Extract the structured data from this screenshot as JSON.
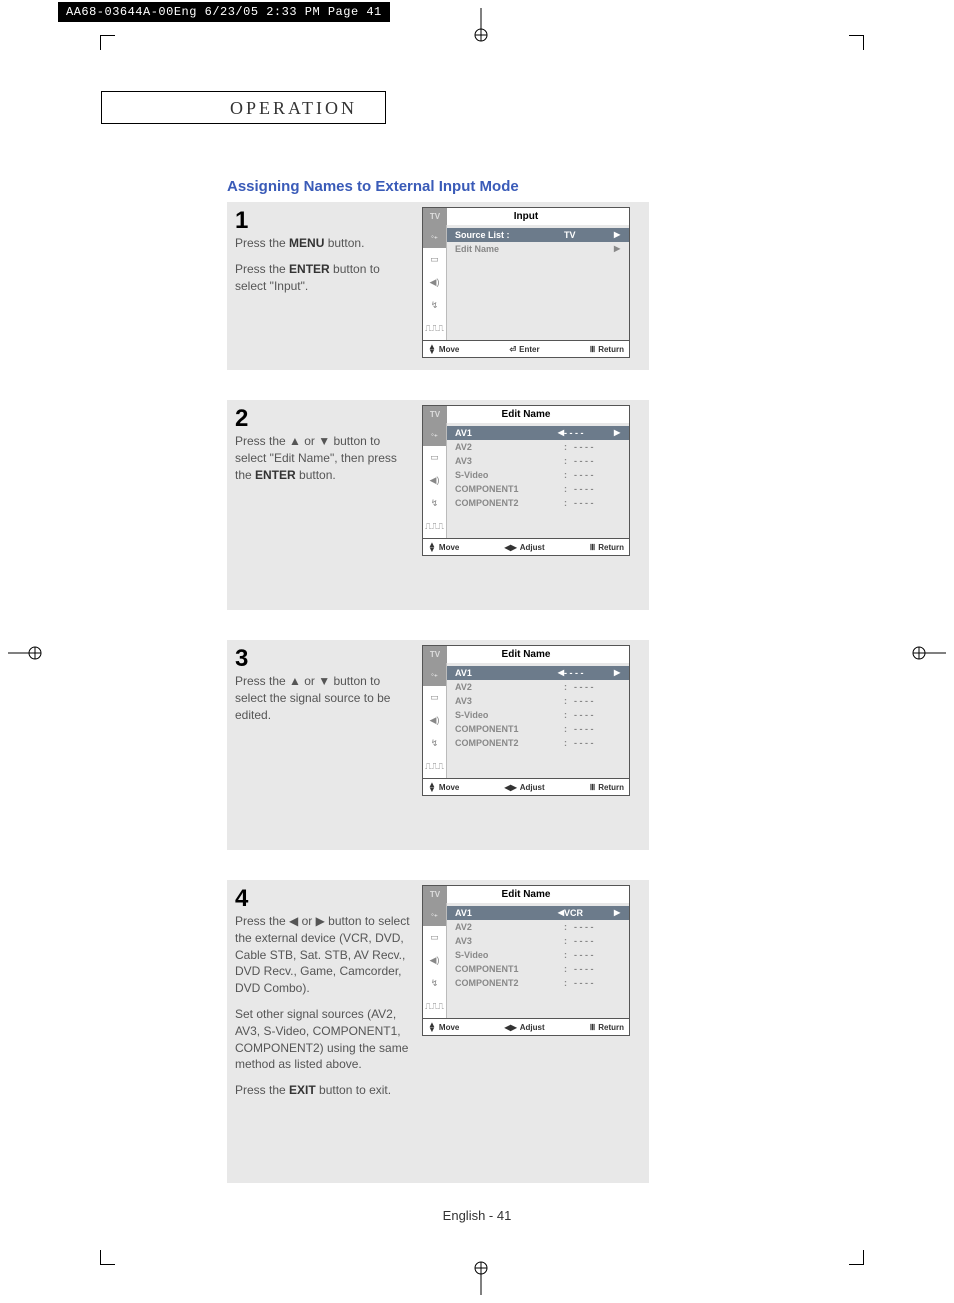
{
  "header_bar": "AA68-03644A-00Eng  6/23/05  2:33 PM  Page 41",
  "section_title": "Operation",
  "page_title": "Assigning Names to External Input Mode",
  "footer": "English - 41",
  "osd_tv_label": "TV",
  "footer_actions": {
    "move": "Move",
    "enter": "Enter",
    "adjust": "Adjust",
    "return": "Return"
  },
  "steps": [
    {
      "num": "1",
      "desc_html": [
        "Press the <b>MENU</b> button.",
        "Press the <b>ENTER</b> button to select \"Input\"."
      ],
      "osd": {
        "title": "Input",
        "type": "input",
        "rows": [
          {
            "label": "Source List :",
            "value": "TV",
            "selected": true,
            "rightArrow": true
          },
          {
            "label": "Edit Name",
            "value": "",
            "selected": false,
            "rightArrow": true
          }
        ],
        "footer_type": "enter"
      }
    },
    {
      "num": "2",
      "desc_html": [
        "Press the ▲ or ▼ button to select \"Edit Name\", then press the <b>ENTER</b> button."
      ],
      "osd": {
        "title": "Edit Name",
        "type": "editname",
        "rows": [
          {
            "label": "AV1",
            "value": "- - - -",
            "selected": true,
            "leftArrow": true,
            "rightArrow": true
          },
          {
            "label": "AV2",
            "colon": ":",
            "value": "- - - -"
          },
          {
            "label": "AV3",
            "colon": ":",
            "value": "- - - -"
          },
          {
            "label": "S-Video",
            "colon": ":",
            "value": "- - - -"
          },
          {
            "label": "COMPONENT1",
            "colon": ":",
            "value": "- - - -"
          },
          {
            "label": "COMPONENT2",
            "colon": ":",
            "value": "- - - -"
          }
        ],
        "footer_type": "adjust"
      }
    },
    {
      "num": "3",
      "desc_html": [
        "Press the ▲ or ▼ button to select the signal source to be edited."
      ],
      "osd": {
        "title": "Edit Name",
        "type": "editname",
        "rows": [
          {
            "label": "AV1",
            "value": "- - - -",
            "selected": true,
            "leftArrow": true,
            "rightArrow": true
          },
          {
            "label": "AV2",
            "colon": ":",
            "value": "- - - -"
          },
          {
            "label": "AV3",
            "colon": ":",
            "value": "- - - -"
          },
          {
            "label": "S-Video",
            "colon": ":",
            "value": "- - - -"
          },
          {
            "label": "COMPONENT1",
            "colon": ":",
            "value": "- - - -"
          },
          {
            "label": "COMPONENT2",
            "colon": ":",
            "value": "- - - -"
          }
        ],
        "footer_type": "adjust"
      }
    },
    {
      "num": "4",
      "desc_html": [
        "Press the ◀ or ▶ button to select the external device (VCR, DVD, Cable STB, Sat. STB, AV Recv., DVD Recv., Game, Camcorder, DVD Combo).",
        "Set other signal sources (AV2, AV3, S-Video, COMPONENT1, COMPONENT2) using the same method as listed above.",
        "Press the <b>EXIT</b> button to exit."
      ],
      "osd": {
        "title": "Edit Name",
        "type": "editname",
        "rows": [
          {
            "label": "AV1",
            "value": "VCR",
            "selected": true,
            "leftArrow": true,
            "rightArrow": true
          },
          {
            "label": "AV2",
            "colon": ":",
            "value": "- - - -"
          },
          {
            "label": "AV3",
            "colon": ":",
            "value": "- - - -"
          },
          {
            "label": "S-Video",
            "colon": ":",
            "value": "- - - -"
          },
          {
            "label": "COMPONENT1",
            "colon": ":",
            "value": "- - - -"
          },
          {
            "label": "COMPONENT2",
            "colon": ":",
            "value": "- - - -"
          }
        ],
        "footer_type": "adjust"
      }
    }
  ]
}
